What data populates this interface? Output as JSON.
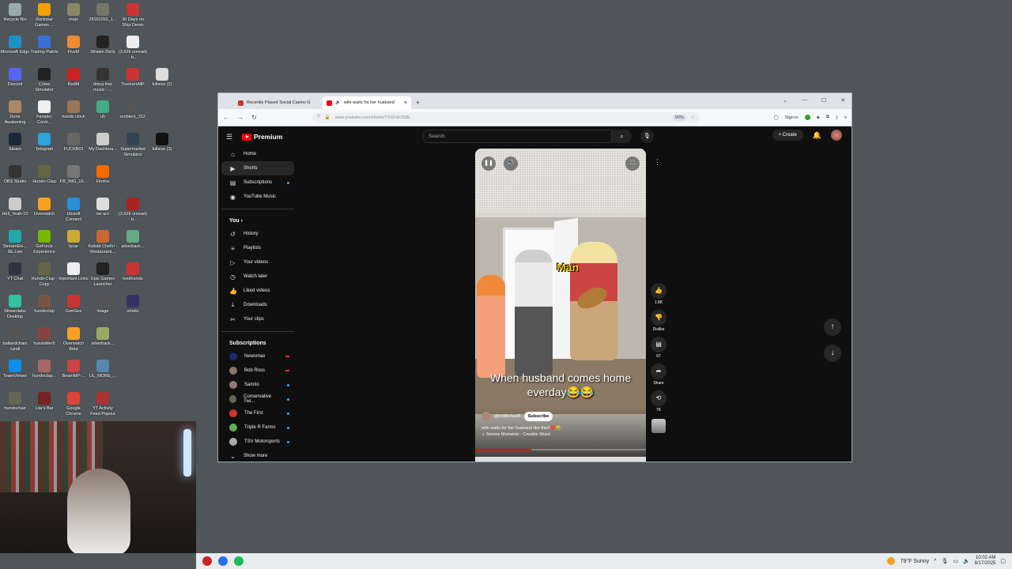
{
  "desktop": {
    "icons": [
      {
        "label": "Recycle Bin",
        "color": "#9aa"
      },
      {
        "label": "Rockstar Games ...",
        "color": "#f5a000"
      },
      {
        "label": "mojo",
        "color": "#886"
      },
      {
        "label": "28162261_1...",
        "color": "#776"
      },
      {
        "label": "30 Days on Ship Demo",
        "color": "#c33"
      },
      {
        "label": "Microsoft Edge",
        "color": "#1e90c8"
      },
      {
        "label": "Trading Paints",
        "color": "#3b6fd8"
      },
      {
        "label": "FiveM",
        "color": "#f08a30"
      },
      {
        "label": "Stream Deck",
        "color": "#222"
      },
      {
        "label": "(3,626 unread) - b...",
        "color": "#eee"
      },
      {
        "label": "Discord",
        "color": "#5865f2"
      },
      {
        "label": "Crime Simulator",
        "color": "#222"
      },
      {
        "label": "RedM",
        "color": "#c22"
      },
      {
        "label": "dmca free music - ...",
        "color": "#333"
      },
      {
        "label": "TruckersMP",
        "color": "#c33"
      },
      {
        "label": "fullsize (2)",
        "color": "#ddd"
      },
      {
        "label": "Dune Awakening",
        "color": "#a86"
      },
      {
        "label": "Fanatec Contr...",
        "color": "#eee"
      },
      {
        "label": "hundo clock",
        "color": "#975"
      },
      {
        "label": "uh",
        "color": "#4a8"
      },
      {
        "label": "emblem_312",
        "color": "#555"
      },
      {
        "label": "Steam",
        "color": "#1b2838"
      },
      {
        "label": "Telegram",
        "color": "#2aa3df"
      },
      {
        "label": "FUCKBOI",
        "color": "#666"
      },
      {
        "label": "My Dashboa...",
        "color": "#ccc"
      },
      {
        "label": "Supermarket Simulator",
        "color": "#345"
      },
      {
        "label": "fullsize (3)",
        "color": "#111"
      },
      {
        "label": "OBS Studio",
        "color": "#333"
      },
      {
        "label": "Hundo-Clap",
        "color": "#664"
      },
      {
        "label": "FB_IMG_16...",
        "color": "#777"
      },
      {
        "label": "Firefox",
        "color": "#f66a00"
      },
      {
        "label": "Hell_Yeah-10",
        "color": "#ccc"
      },
      {
        "label": "Overwatch",
        "color": "#f8a020"
      },
      {
        "label": "Ubisoft Connect",
        "color": "#2a8fd8"
      },
      {
        "label": "ow acc",
        "color": "#ddd"
      },
      {
        "label": "(3,626 unread) - b...",
        "color": "#a22"
      },
      {
        "label": "StreamEle... SE.Live",
        "color": "#2aa"
      },
      {
        "label": "GeForce Experience",
        "color": "#76b900"
      },
      {
        "label": "tycar",
        "color": "#ca3"
      },
      {
        "label": "Kebab Chefs! - Restaurant...",
        "color": "#c63"
      },
      {
        "label": "silverback...",
        "color": "#6a8"
      },
      {
        "label": "YT Chat",
        "color": "#334"
      },
      {
        "label": "Hundo-Clap - Copy",
        "color": "#664"
      },
      {
        "label": "Important Links",
        "color": "#eee"
      },
      {
        "label": "Epic Games Launcher",
        "color": "#222"
      },
      {
        "label": "koolhundo",
        "color": "#c33"
      },
      {
        "label": "Streamlabs Desktop",
        "color": "#31c3a2"
      },
      {
        "label": "hundoclap",
        "color": "#754"
      },
      {
        "label": "GeeGee",
        "color": "#c33"
      },
      {
        "label": "image",
        "color": "#555"
      },
      {
        "label": "omelu",
        "color": "#336"
      },
      {
        "label": "ballandchain cyndi",
        "color": "#555"
      },
      {
        "label": "hundotiler9",
        "color": "#844"
      },
      {
        "label": "Overwatch Beta",
        "color": "#f8a020"
      },
      {
        "label": "silverback...",
        "color": "#9a6"
      },
      {
        "label": "TeamViewer",
        "color": "#0e8ee9"
      },
      {
        "label": "hundoclap...",
        "color": "#a66"
      },
      {
        "label": "BeamMP-...",
        "color": "#c44"
      },
      {
        "label": "LIL_MORE_...",
        "color": "#58a"
      },
      {
        "label": "hundochair",
        "color": "#665"
      },
      {
        "label": "Liar's Bar",
        "color": "#722"
      },
      {
        "label": "Google Chrome",
        "color": "#db4437"
      },
      {
        "label": "YT Activity Feed Popout",
        "color": "#a33"
      }
    ]
  },
  "taskbar": {
    "apps": [
      {
        "name": "app-1",
        "color": "#c22"
      },
      {
        "name": "app-2",
        "color": "#2a6ef0"
      },
      {
        "name": "app-3",
        "color": "#1db954"
      }
    ],
    "weather": "79°F  Sunny",
    "time": "10:02 AM",
    "date": "8/17/2025"
  },
  "browser": {
    "tabs": [
      {
        "title": "Recently Played Social Casino G",
        "color": "#c33"
      },
      {
        "title": "wife waits for her husband",
        "color": "#f00"
      }
    ],
    "new_tab": "+",
    "url": "www.youtube.com/shorts/TXXFxlIJ56E",
    "zoom": "90%",
    "signin": "Sign in"
  },
  "youtube": {
    "logo": "Premium",
    "search_placeholder": "Search",
    "create": "Create",
    "nav": [
      {
        "label": "Home",
        "icon": "⌂"
      },
      {
        "label": "Shorts",
        "icon": "▶"
      },
      {
        "label": "Subscriptions",
        "icon": "▤"
      },
      {
        "label": "YouTube Music",
        "icon": "◉"
      }
    ],
    "you_header": "You",
    "you_items": [
      {
        "label": "History",
        "icon": "↺"
      },
      {
        "label": "Playlists",
        "icon": "≡"
      },
      {
        "label": "Your videos",
        "icon": "▷"
      },
      {
        "label": "Watch later",
        "icon": "◷"
      },
      {
        "label": "Liked videos",
        "icon": "👍"
      },
      {
        "label": "Downloads",
        "icon": "⤓"
      },
      {
        "label": "Your clips",
        "icon": "✂"
      }
    ],
    "subscriptions_header": "Subscriptions",
    "subscriptions": [
      {
        "label": "Newsmax",
        "color": "#1a2a6a"
      },
      {
        "label": "Bob Ross",
        "color": "#876"
      },
      {
        "label": "Samito",
        "color": "#977"
      },
      {
        "label": "Conservative Twi...",
        "color": "#665"
      },
      {
        "label": "The First",
        "color": "#c33"
      },
      {
        "label": "Triple R Farms",
        "color": "#6a5"
      },
      {
        "label": "TSV Motorsports",
        "color": "#aaa"
      }
    ],
    "show_more": "Show more",
    "short": {
      "overlay_word": "Man",
      "caption": "When husband comes home everday😂😂",
      "channel": "@ImMichael5",
      "subscribe": "Subscribe",
      "title": "wife waits for her husband like this!!❤️😂",
      "music": "♫ Serene Moments · Creable Music",
      "progress": 0.33
    },
    "actions": {
      "likes": "1.8K",
      "dislike": "Dislike",
      "comments": "67",
      "share": "Share",
      "remix": "7K"
    }
  }
}
